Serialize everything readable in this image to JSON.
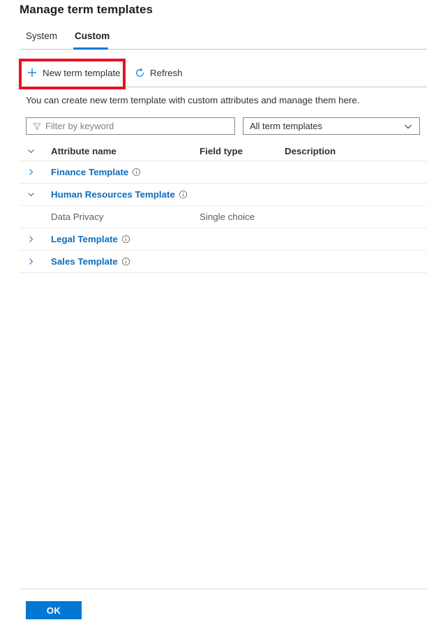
{
  "page": {
    "title": "Manage term templates"
  },
  "tabs": [
    {
      "label": "System",
      "selected": false
    },
    {
      "label": "Custom",
      "selected": true
    }
  ],
  "toolbar": {
    "new_label": "New term template",
    "new_icon": "plus-icon",
    "refresh_label": "Refresh",
    "refresh_icon": "refresh-icon",
    "highlight_color": "#e81123"
  },
  "description": "You can create new term template with custom attributes and manage them here.",
  "filter": {
    "placeholder": "Filter by keyword",
    "value": "",
    "icon": "filter-icon"
  },
  "template_select": {
    "value": "All term templates",
    "chevron": "chevron-down-icon"
  },
  "table": {
    "columns": {
      "attribute_name": "Attribute name",
      "field_type": "Field type",
      "description": "Description"
    },
    "rows": [
      {
        "kind": "template",
        "name": "Finance Template",
        "expanded": false,
        "field_type": "",
        "description": ""
      },
      {
        "kind": "template",
        "name": "Human Resources Template",
        "expanded": true,
        "field_type": "",
        "description": ""
      },
      {
        "kind": "attribute",
        "name": "Data Privacy",
        "field_type": "Single choice",
        "description": ""
      },
      {
        "kind": "template",
        "name": "Legal Template",
        "expanded": false,
        "field_type": "",
        "description": ""
      },
      {
        "kind": "template",
        "name": "Sales Template",
        "expanded": false,
        "field_type": "",
        "description": ""
      }
    ]
  },
  "footer": {
    "ok_label": "OK",
    "ok_color": "#0078d4"
  },
  "colors": {
    "accent": "#0078d4",
    "link": "#0f6cbd",
    "highlight": "#e81123"
  }
}
